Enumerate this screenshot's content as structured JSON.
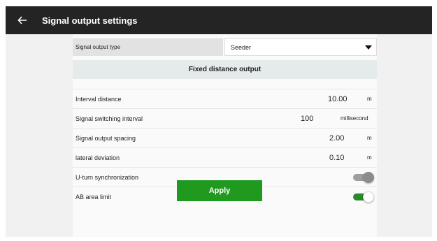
{
  "header": {
    "title": "Signal output settings",
    "back_icon": "back-arrow-icon"
  },
  "signal_output_type": {
    "label": "Signal output type",
    "value": "Seeder",
    "dropdown_icon": "caret-down-icon"
  },
  "section_title": "Fixed distance output",
  "rows": [
    {
      "label": "Interval distance",
      "value": "10.00",
      "unit": "m"
    },
    {
      "label": "Signal switching interval",
      "value": "100",
      "unit": "millisecond"
    },
    {
      "label": "Signal output spacing",
      "value": "2.00",
      "unit": "m"
    },
    {
      "label": "lateral deviation",
      "value": "0.10",
      "unit": "m"
    },
    {
      "label": "U-turn synchronization",
      "toggle": false
    },
    {
      "label": "AB area limit",
      "toggle": true
    }
  ],
  "apply_label": "Apply",
  "colors": {
    "appbar": "#242424",
    "accent_green": "#1f9a1f",
    "section_bg": "#e4ebea"
  }
}
